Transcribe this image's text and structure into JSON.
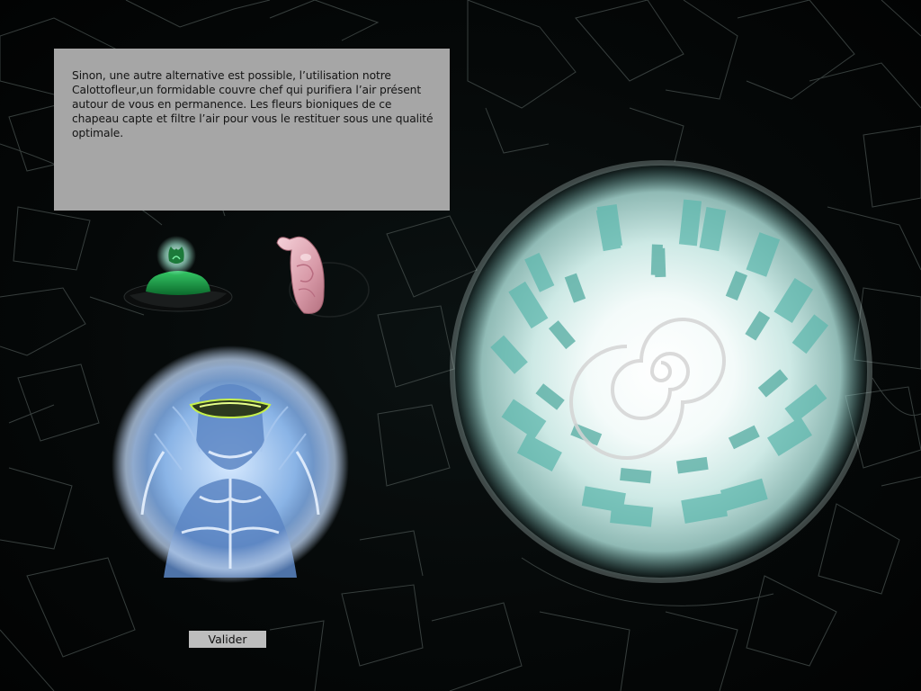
{
  "dialog": {
    "text": "Sinon, une autre alternative est possible, l’utilisation notre Calottofleur,un formidable couvre chef qui purifiera l’air présent autour de vous en permanence. Les fleurs bioniques de ce chapeau capte et filtre l’air pour vous le restituer sous une qualité optimale."
  },
  "inventory": [
    {
      "name": "flower-hat",
      "icon": "green-flower-hat-icon"
    },
    {
      "name": "pink-organic-glove",
      "icon": "pink-glove-icon"
    }
  ],
  "colors": {
    "background": "#050808",
    "dialog_bg": "#a6a6a6",
    "button_bg": "#bdbdbd",
    "portal_glow": "#bfe6e2",
    "avatar_glow": "#9fc7f0",
    "lines": "#5a6565"
  },
  "buttons": {
    "validate": "Valider"
  }
}
